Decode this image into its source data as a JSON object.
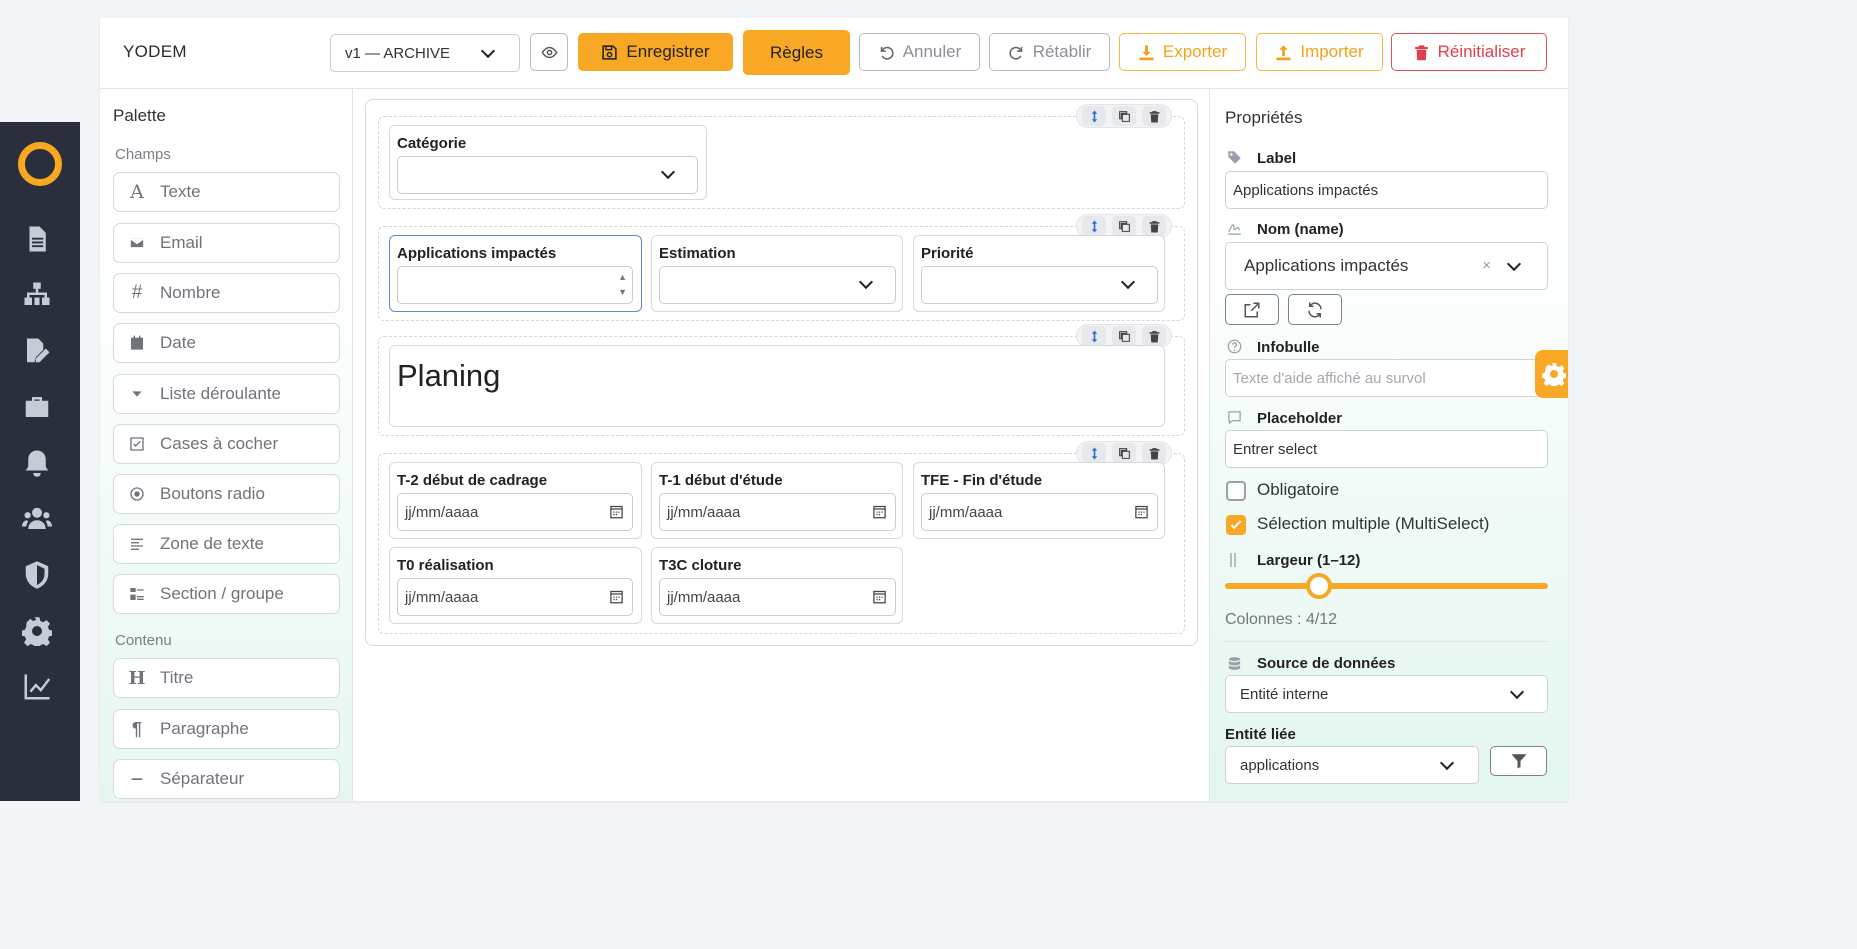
{
  "toolbar": {
    "brand": "YODEM",
    "version_select": "v1 — ARCHIVE",
    "save_label": "Enregistrer",
    "rules_label": "Règles",
    "undo_label": "Annuler",
    "redo_label": "Rétablir",
    "export_label": "Exporter",
    "import_label": "Importer",
    "reset_label": "Réinitialiser"
  },
  "palette": {
    "title": "Palette",
    "section_fields": "Champs",
    "fields": [
      {
        "label": "Texte",
        "icon": "text-icon"
      },
      {
        "label": "Email",
        "icon": "envelope-icon"
      },
      {
        "label": "Nombre",
        "icon": "hash-icon"
      },
      {
        "label": "Date",
        "icon": "calendar-icon"
      },
      {
        "label": "Liste déroulante",
        "icon": "caret-down-icon"
      },
      {
        "label": "Cases à cocher",
        "icon": "checkbox-icon"
      },
      {
        "label": "Boutons radio",
        "icon": "radio-icon"
      },
      {
        "label": "Zone de texte",
        "icon": "textarea-icon"
      },
      {
        "label": "Section / groupe",
        "icon": "section-icon"
      }
    ],
    "section_content": "Contenu",
    "content": [
      {
        "label": "Titre",
        "icon": "heading-icon"
      },
      {
        "label": "Paragraphe",
        "icon": "paragraph-icon"
      },
      {
        "label": "Séparateur",
        "icon": "separator-icon"
      }
    ]
  },
  "canvas": {
    "row1": {
      "categorie_label": "Catégorie"
    },
    "row2": {
      "apps_label": "Applications impactés",
      "estimation_label": "Estimation",
      "priorite_label": "Priorité"
    },
    "row3": {
      "heading_text": "Planing"
    },
    "row4": {
      "t2_label": "T-2 début de cadrage",
      "t1_label": "T-1 début d'étude",
      "tfe_label": "TFE - Fin d'étude",
      "t0_label": "T0 réalisation",
      "t3c_label": "T3C cloture",
      "date_placeholder": "jj/mm/aaaa"
    }
  },
  "properties": {
    "title": "Propriétés",
    "label_label": "Label",
    "label_value": "Applications impactés",
    "name_label": "Nom (name)",
    "name_value": "Applications impactés",
    "clear_symbol": "×",
    "tooltip_label": "Infobulle",
    "tooltip_placeholder": "Texte d'aide affiché au survol",
    "placeholder_label": "Placeholder",
    "placeholder_value": "Entrer select",
    "required_label": "Obligatoire",
    "required_checked": false,
    "multiselect_label": "Sélection multiple (MultiSelect)",
    "multiselect_checked": true,
    "width_label": "Largeur (1–12)",
    "width_value": 4,
    "columns_text": "Colonnes : 4/12",
    "source_label": "Source de données",
    "source_value": "Entité interne",
    "entity_label": "Entité liée",
    "entity_value": "applications"
  },
  "colors": {
    "accent": "#f9a825",
    "nav_bg": "#2b2f3d",
    "danger": "#e0404e"
  }
}
